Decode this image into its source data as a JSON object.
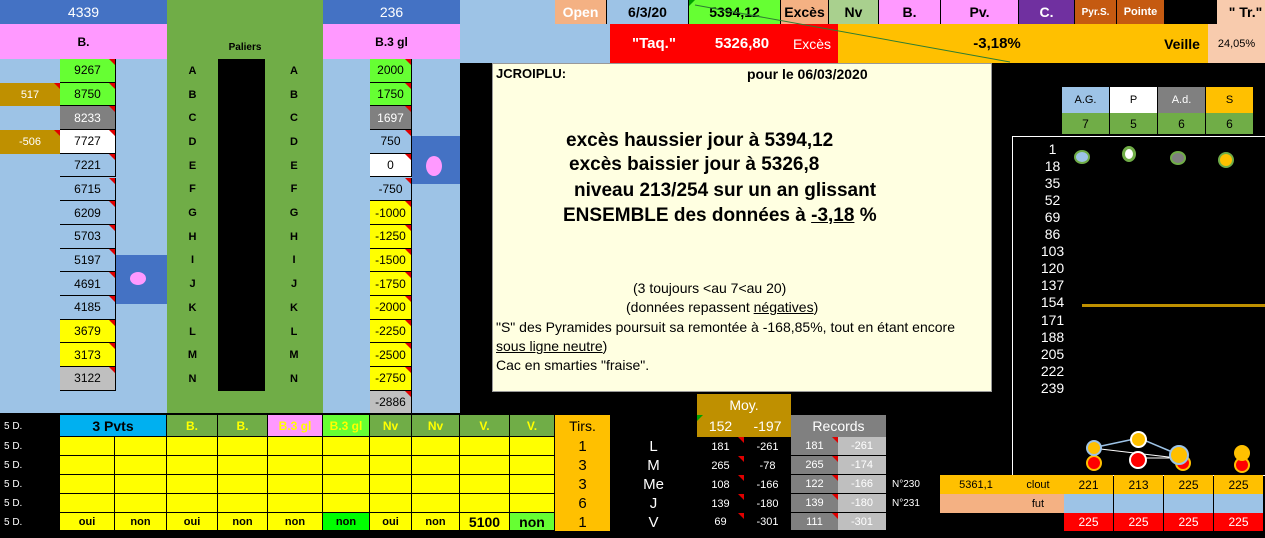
{
  "top_left": {
    "col1_header": "4339",
    "col1_sub": "B.",
    "paliers": "Paliers",
    "col3_header": "236",
    "col3_sub": "B.3 gl"
  },
  "levels_b": [
    {
      "v": "9267",
      "bg": "#66ff33"
    },
    {
      "v": "8750",
      "bg": "#66ff33"
    },
    {
      "v": "8233",
      "bg": "#808080",
      "c": "#fff"
    },
    {
      "v": "7727",
      "bg": "#ffffff"
    },
    {
      "v": "7221",
      "bg": "#9dc3e6"
    },
    {
      "v": "6715",
      "bg": "#9dc3e6"
    },
    {
      "v": "6209",
      "bg": "#9dc3e6"
    },
    {
      "v": "5703",
      "bg": "#9dc3e6"
    },
    {
      "v": "5197",
      "bg": "#9dc3e6"
    },
    {
      "v": "4691",
      "bg": "#9dc3e6"
    },
    {
      "v": "4185",
      "bg": "#9dc3e6"
    },
    {
      "v": "3679",
      "bg": "#ffff00"
    },
    {
      "v": "3173",
      "bg": "#ffff00"
    },
    {
      "v": "3122",
      "bg": "#bfbfbf"
    }
  ],
  "side_b": [
    {
      "row": 1,
      "v": "517"
    },
    {
      "row": 3,
      "v": "-506"
    }
  ],
  "letters": [
    "A",
    "B",
    "C",
    "D",
    "E",
    "F",
    "G",
    "H",
    "I",
    "J",
    "K",
    "L",
    "M",
    "N"
  ],
  "levels_b3": [
    {
      "v": "2000",
      "bg": "#66ff33"
    },
    {
      "v": "1750",
      "bg": "#66ff33"
    },
    {
      "v": "1697",
      "bg": "#808080",
      "c": "#fff"
    },
    {
      "v": "750",
      "bg": "#9dc3e6"
    },
    {
      "v": "0",
      "bg": "#ffffff"
    },
    {
      "v": "-750",
      "bg": "#9dc3e6"
    },
    {
      "v": "-1000",
      "bg": "#ffff00"
    },
    {
      "v": "-1250",
      "bg": "#ffff00"
    },
    {
      "v": "-1500",
      "bg": "#ffff00"
    },
    {
      "v": "-1750",
      "bg": "#ffff00"
    },
    {
      "v": "-2000",
      "bg": "#ffff00"
    },
    {
      "v": "-2250",
      "bg": "#ffff00"
    },
    {
      "v": "-2500",
      "bg": "#ffff00"
    },
    {
      "v": "-2750",
      "bg": "#ffff00"
    },
    {
      "v": "-2886",
      "bg": "#bfbfbf"
    }
  ],
  "header1": [
    {
      "v": "Open",
      "bg": "#f4b183",
      "c": "#fff",
      "w": 52
    },
    {
      "v": "6/3/20",
      "bg": "#9dc3e6",
      "w": 82
    },
    {
      "v": "5394,12",
      "bg": "#66ff33",
      "w": 92
    },
    {
      "v": "Excès",
      "bg": "#f4b183",
      "w": 48
    },
    {
      "v": "Nv",
      "bg": "#a9d08e",
      "w": 50
    },
    {
      "v": "B.",
      "bg": "#ff99ff",
      "w": 62
    },
    {
      "v": "Pv.",
      "bg": "#ff99ff",
      "w": 78
    },
    {
      "v": "C.",
      "bg": "#7030a0",
      "c": "#fff",
      "w": 56
    },
    {
      "v": "Pyr.S.",
      "bg": "#c55a11",
      "c": "#fff",
      "w": 42,
      "fs": 10
    },
    {
      "v": "Pointe",
      "bg": "#c55a11",
      "c": "#fff",
      "w": 48,
      "fs": 11
    },
    {
      "v": "",
      "bg": "#000",
      "w": 52
    },
    {
      "v": "\" Tr.\"",
      "bg": "#f8cbad",
      "w": 58
    }
  ],
  "header2": {
    "taq": "\"Taq.\"",
    "taq_val": "5326,80",
    "exces": "Excès",
    "pct": "-3,18%",
    "veille": "Veille",
    "veille_val": "24,05%"
  },
  "note": {
    "name": "JCROIPLU:",
    "date_label": "pour le  06/03/2020",
    "line1": "excès haussier jour à 5394,12",
    "line2": "excès baissier jour à 5326,8",
    "line3": "niveau 213/254 sur un an glissant",
    "line4a": "ENSEMBLE des données à ",
    "line4b": "-3,18",
    "line4c": " %",
    "s1": "(3 toujours <au 7<au 20)",
    "s2a": "(données repassent ",
    "s2b": "négatives",
    "s2c": ")",
    "s3": "\"S\" des Pyramides poursuit sa remontée à -168,85%, tout en étant encore",
    "s4a": "sous ligne neutre",
    "s4b": ")",
    "s5": "Cac en smarties \"fraise\"."
  },
  "right_panel": {
    "headers": [
      {
        "v": "A.G.",
        "bg": "#9dc3e6",
        "c": "#000"
      },
      {
        "v": "P",
        "bg": "#ffffff",
        "c": "#000"
      },
      {
        "v": "A.d.",
        "bg": "#808080",
        "c": "#fff"
      },
      {
        "v": "S",
        "bg": "#ffc000",
        "c": "#000"
      }
    ],
    "counts": [
      "7",
      "5",
      "6",
      "6"
    ],
    "scale": [
      "1",
      "18",
      "35",
      "52",
      "69",
      "86",
      "103",
      "120",
      "137",
      "154",
      "171",
      "188",
      "205",
      "222",
      "239"
    ]
  },
  "bottom_table": {
    "headers": [
      {
        "v": "3 Pvts",
        "bg": "#00b0f0",
        "c": "#000"
      },
      {
        "v": "B.",
        "bg": "#70ad47",
        "c": "#ffff00"
      },
      {
        "v": "B.",
        "bg": "#70ad47",
        "c": "#ffff00"
      },
      {
        "v": "B.3 gl",
        "bg": "#ff99ff",
        "c": "#ffff00"
      },
      {
        "v": "B.3 gl",
        "bg": "#66ff33",
        "c": "#ffff00"
      },
      {
        "v": "Nv",
        "bg": "#70ad47",
        "c": "#ffff00"
      },
      {
        "v": "Nv",
        "bg": "#70ad47",
        "c": "#ffff00"
      },
      {
        "v": "V.",
        "bg": "#70ad47",
        "c": "#ffff00"
      },
      {
        "v": "V.",
        "bg": "#70ad47",
        "c": "#ffff00"
      }
    ],
    "row_label": "5 D.",
    "last_row": [
      "oui",
      "non",
      "oui",
      "non",
      "non",
      "non",
      "oui",
      "non",
      "5100",
      "non"
    ],
    "tirs_header": "Tirs.",
    "tirs": [
      "1",
      "3",
      "3",
      "6",
      "1"
    ],
    "days": [
      "L",
      "M",
      "Me",
      "J",
      "V"
    ],
    "moy_header": "Moy.",
    "moy_vals": [
      "152",
      "-197"
    ],
    "records_header": "Records",
    "moy": [
      [
        "181",
        "-261"
      ],
      [
        "265",
        "-78"
      ],
      [
        "108",
        "-166"
      ],
      [
        "139",
        "-180"
      ],
      [
        "69",
        "-301"
      ]
    ],
    "rec": [
      [
        "181",
        "-261"
      ],
      [
        "265",
        "-174"
      ],
      [
        "122",
        "-166"
      ],
      [
        "139",
        "-180"
      ],
      [
        "111",
        "-301"
      ]
    ]
  },
  "bottom_right": {
    "n230": "N°230",
    "n231": "N°231",
    "v5361": "5361,1",
    "clout": "clout",
    "fut": "fut",
    "row1": [
      "221",
      "213",
      "225",
      "225"
    ],
    "row3": [
      "225",
      "225",
      "225",
      "225"
    ]
  }
}
